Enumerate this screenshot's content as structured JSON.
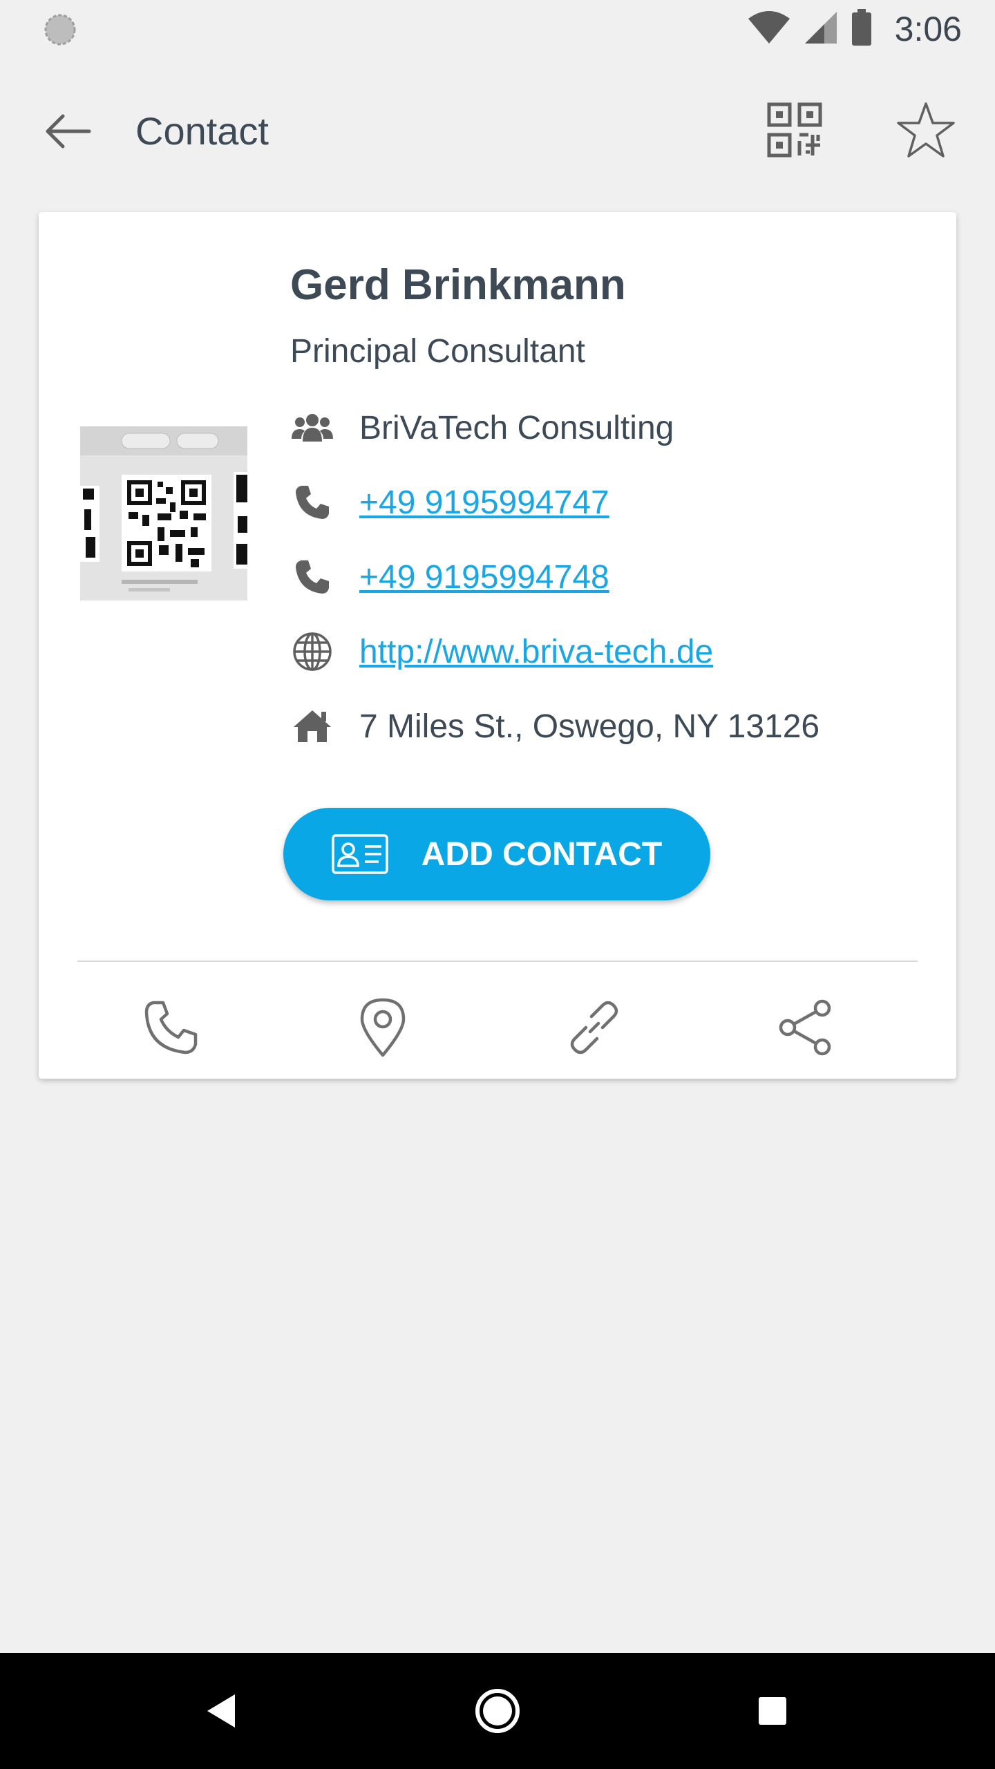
{
  "status_bar": {
    "time": "3:06",
    "icons": [
      "sync-icon",
      "wifi-icon",
      "signal-icon",
      "battery-icon"
    ]
  },
  "app_bar": {
    "title": "Contact",
    "icons": [
      "back-arrow-icon",
      "qr-code-icon",
      "star-icon"
    ]
  },
  "contact": {
    "name": "Gerd Brinkmann",
    "job_title": "Principal Consultant",
    "company": "BriVaTech Consulting",
    "phone_1": "+49 9195994747",
    "phone_2": "+49 9195994748",
    "website": "http://www.briva-tech.de",
    "address": "7 Miles St., Oswego, NY 13126"
  },
  "add_contact_button": {
    "label": "ADD CONTACT",
    "icon": "contact-card-icon"
  },
  "actions": [
    "phone-icon",
    "location-pin-icon",
    "link-icon",
    "share-icon"
  ],
  "nav_bar": [
    "back-triangle-icon",
    "home-circle-icon",
    "recents-square-icon"
  ],
  "colors": {
    "accent": "#0aa7e6",
    "link": "#1aa6e4",
    "text": "#3d4a56",
    "background": "#f0f0f0",
    "icon_gray": "#707070"
  }
}
